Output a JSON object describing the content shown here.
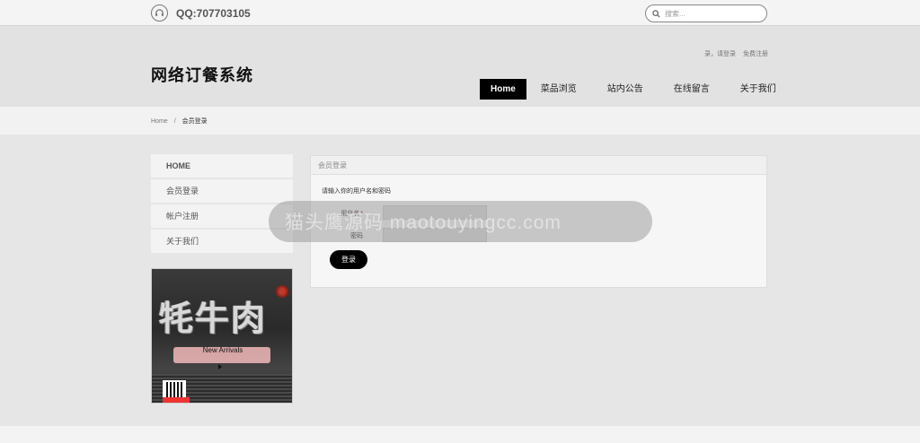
{
  "topbar": {
    "qq_label": "QQ:707703105",
    "search_placeholder": "搜索..."
  },
  "header": {
    "site_title": "网络订餐系统",
    "auth_links": [
      "录，请登录",
      "免费注册"
    ]
  },
  "nav": {
    "items": [
      "Home",
      "菜品浏览",
      "站内公告",
      "在线留言",
      "关于我们"
    ],
    "active_index": 0
  },
  "breadcrumb": {
    "home": "Home",
    "separator": "/",
    "current": "会员登录"
  },
  "sidebar": {
    "items": [
      "HOME",
      "会员登录",
      "帐户注册",
      "关于我们"
    ]
  },
  "promo": {
    "title": "牦牛肉",
    "arrivals": "New Arrivals"
  },
  "login": {
    "panel_title": "会员登录",
    "hint": "请输入你的用户名和密码",
    "username_label": "用户名",
    "required_mark": "*",
    "password_label": "密码",
    "username_value": "",
    "password_value": "",
    "submit_label": "登录"
  },
  "watermark": {
    "text": "猫头鹰源码 maotouyingcc.com"
  },
  "colors": {
    "nav_active_bg": "#000000",
    "page_bg": "#e6e6e6",
    "button_bg": "#000000"
  }
}
